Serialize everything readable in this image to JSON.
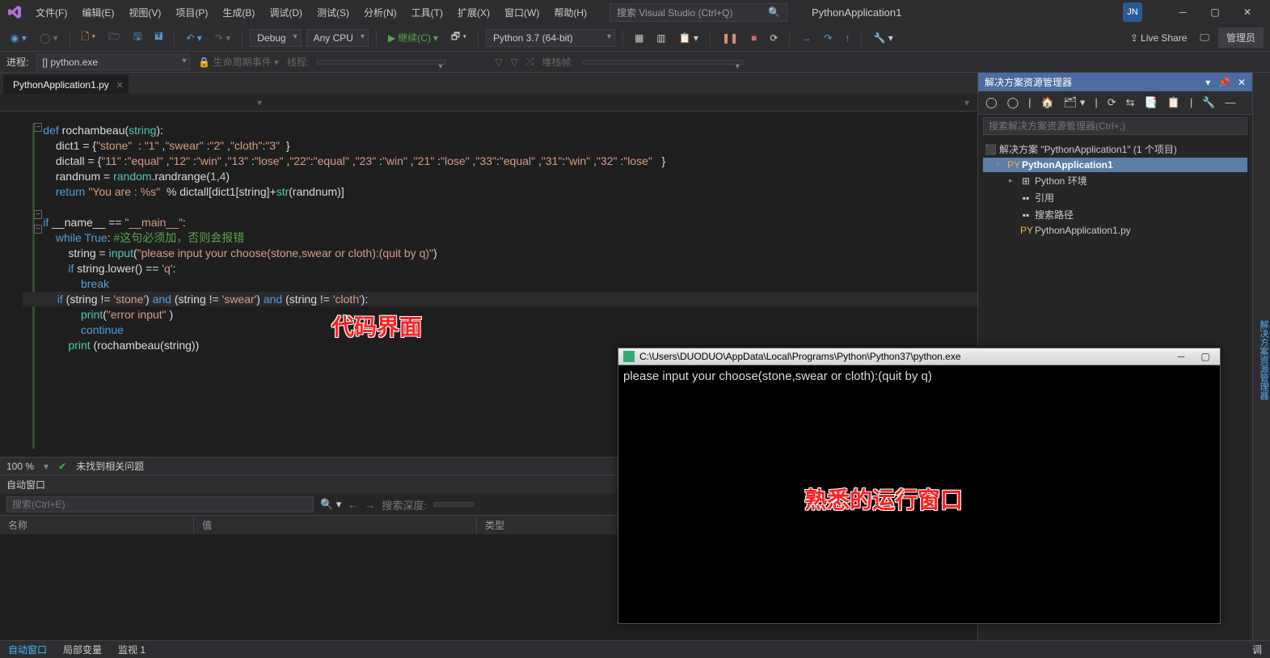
{
  "menu": [
    "文件(F)",
    "编辑(E)",
    "视图(V)",
    "项目(P)",
    "生成(B)",
    "调试(D)",
    "测试(S)",
    "分析(N)",
    "工具(T)",
    "扩展(X)",
    "窗口(W)",
    "帮助(H)"
  ],
  "searchPlaceholder": "搜索 Visual Studio (Ctrl+Q)",
  "appTitle": "PythonApplication1",
  "userBadge": "JN",
  "toolbar": {
    "config": "Debug",
    "platform": "Any CPU",
    "continue": "继续(C)",
    "python": "Python 3.7 (64-bit)",
    "liveshare": "Live Share",
    "admin": "管理员"
  },
  "procbar": {
    "procLabel": "进程:",
    "proc": "[] python.exe",
    "lifecycle": "生命周期事件",
    "thread": "线程:",
    "stackframe": "堆栈帧:"
  },
  "tab": "PythonApplication1.py",
  "code": {
    "l1a": "def",
    "l1b": " rochambeau(",
    "l1c": "string",
    "l1d": "):",
    "l2a": "    dict1 = {",
    "l2b": "\"stone\"",
    "l2c": "  : ",
    "l2d": "\"1\"",
    "l2e": " ,",
    "l2f": "\"swear\"",
    "l2g": " :",
    "l2h": "\"2\"",
    "l2i": " ,",
    "l2j": "\"cloth\"",
    "l2k": ":",
    "l2l": "\"3\"",
    "l2m": "  }",
    "l3a": "    dictall = {",
    "l3b": "\"11\"",
    "l3c": " :",
    "l3d": "\"equal\"",
    "l3e": " ,",
    "l3f": "\"12\"",
    "l3g": " :",
    "l3h": "\"win\"",
    "l3i": " ,",
    "l3j": "\"13\"",
    "l3k": " :",
    "l3l": "\"lose\"",
    "l3m": " ,",
    "l3n": "\"22\"",
    "l3o": ":",
    "l3p": "\"equal\"",
    "l3q": " ,",
    "l3r": "\"23\"",
    "l3s": " :",
    "l3t": "\"win\"",
    "l3u": " ,",
    "l3v": "\"21\"",
    "l3w": " :",
    "l3x": "\"lose\"",
    "l3y": " ,",
    "l3z": "\"33\"",
    "l3aa": ":",
    "l3ab": "\"equal\"",
    "l3ac": " ,",
    "l3ad": "\"31\"",
    "l3ae": ":",
    "l3af": "\"win\"",
    "l3ag": " ,",
    "l3ah": "\"32\"",
    "l3ai": " :",
    "l3aj": "\"lose\"",
    "l3ak": "   }",
    "l4a": "    randnum = ",
    "l4b": "random",
    "l4c": ".randrange(",
    "l4d": "1",
    "l4e": ",",
    "l4f": "4",
    "l4g": ")",
    "l5a": "    ",
    "l5b": "return",
    "l5c": " ",
    "l5d": "\"You are : %s\"",
    "l5e": "  % dictall[dict1[string]+",
    "l5f": "str",
    "l5g": "(randnum)]",
    "l6": "",
    "l7a": "if",
    "l7b": " __name__ == ",
    "l7c": "\"__main__\"",
    "l7d": ":",
    "l8a": "    ",
    "l8b": "while",
    "l8c": " ",
    "l8d": "True",
    "l8e": ": ",
    "l8f": "#这句必须加，否则会报错",
    "l9a": "        string = ",
    "l9b": "input",
    "l9c": "(",
    "l9d": "\"please input your choose(stone,swear or cloth):(quit by q)\"",
    "l9e": ")",
    "l10a": "        ",
    "l10b": "if",
    "l10c": " string.lower() == ",
    "l10d": "'q'",
    "l10e": ":",
    "l11a": "            ",
    "l11b": "break",
    "l12a": "        ",
    "l12b": "if",
    "l12c": " (string != ",
    "l12d": "'stone'",
    "l12e": ") ",
    "l12f": "and",
    "l12g": " (string != ",
    "l12h": "'swear'",
    "l12i": ") ",
    "l12j": "and",
    "l12k": " (string != ",
    "l12l": "'cloth'",
    "l12m": "):",
    "l13a": "            ",
    "l13b": "print",
    "l13c": "(",
    "l13d": "\"error input\"",
    "l13e": " )",
    "l14a": "            ",
    "l14b": "continue",
    "l15a": "        ",
    "l15b": "print",
    "l15c": " (rochambeau(string))"
  },
  "annot1": "代码界面",
  "annot2": "熟悉的运行窗口",
  "zoom": "100 %",
  "issues": "未找到相关问题",
  "autos": {
    "title": "自动窗口",
    "searchPlaceholder": "搜索(Ctrl+E)",
    "depthLabel": "搜索深度:",
    "cols": [
      "名称",
      "值",
      "类型"
    ]
  },
  "solExp": {
    "title": "解决方案资源管理器",
    "searchPlaceholder": "搜索解决方案资源管理器(Ctrl+;)",
    "root": "解决方案 \"PythonApplication1\" (1 个项目)",
    "project": "PythonApplication1",
    "env": "Python 环境",
    "refs": "引用",
    "searchPaths": "搜索路径",
    "file": "PythonApplication1.py"
  },
  "console": {
    "title": "C:\\Users\\DUODUO\\AppData\\Local\\Programs\\Python\\Python37\\python.exe",
    "line": "please input your choose(stone,swear or cloth):(quit by q)"
  },
  "bottomTabs": [
    "自动窗口",
    "局部变量",
    "监视 1"
  ],
  "rightTab": "调"
}
